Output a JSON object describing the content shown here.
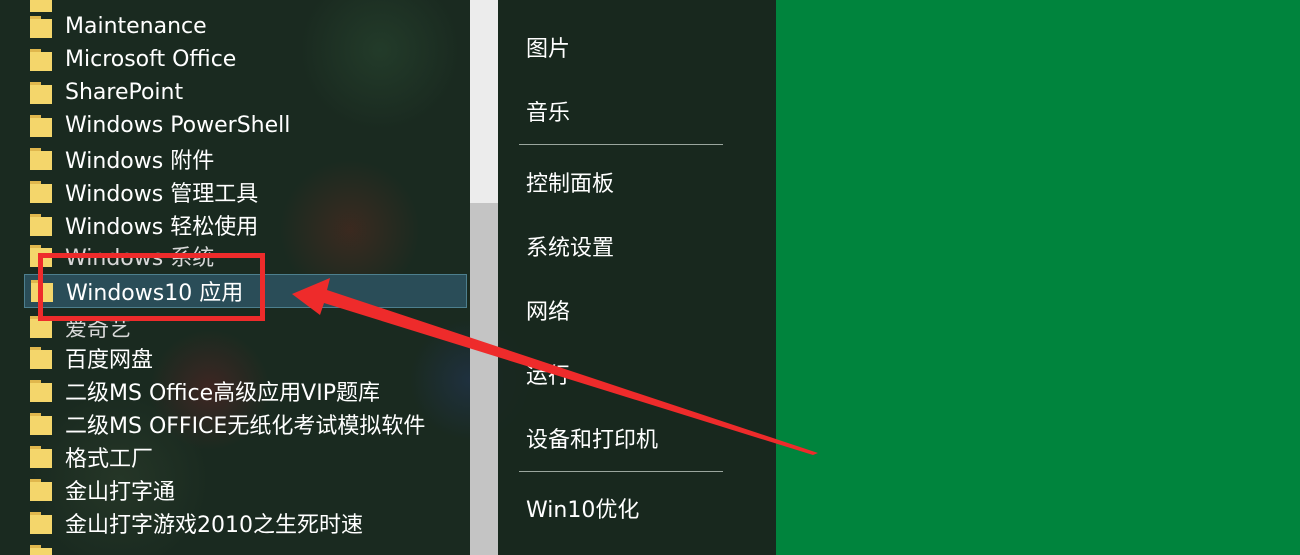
{
  "program_list": {
    "items": [
      {
        "label": "Maintenance"
      },
      {
        "label": "Microsoft Office"
      },
      {
        "label": "SharePoint"
      },
      {
        "label": "Windows PowerShell"
      },
      {
        "label": "Windows 附件"
      },
      {
        "label": "Windows 管理工具"
      },
      {
        "label": "Windows 轻松使用"
      },
      {
        "label": "Windows 系统"
      },
      {
        "label": "Windows10 应用"
      },
      {
        "label": "爱奇艺"
      },
      {
        "label": "百度网盘"
      },
      {
        "label": "二级MS Office高级应用VIP题库"
      },
      {
        "label": "二级MS OFFICE无纸化考试模拟软件"
      },
      {
        "label": "格式工厂"
      },
      {
        "label": "金山打字通"
      },
      {
        "label": "金山打字游戏2010之生死时速"
      }
    ]
  },
  "right_panel": {
    "links": [
      {
        "label": "图片"
      },
      {
        "label": "音乐"
      },
      {
        "label": "控制面板"
      },
      {
        "label": "系统设置"
      },
      {
        "label": "网络"
      },
      {
        "label": "运行"
      },
      {
        "label": "设备和打印机"
      },
      {
        "label": "Win10优化"
      }
    ]
  },
  "colors": {
    "desktop_background": "#00843d",
    "annotation": "#ee2b2b",
    "highlight": "#2a4d58"
  }
}
